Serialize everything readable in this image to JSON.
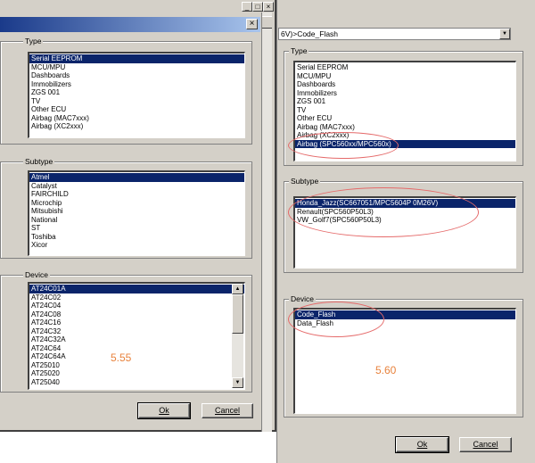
{
  "left_dialog": {
    "type_label": "Type",
    "type_items": [
      "Serial EEPROM",
      "MCU/MPU",
      "Dashboards",
      "Immobilizers",
      "ZGS 001",
      "TV",
      "Other ECU",
      "Airbag (MAC7xxx)",
      "Airbag (XC2xxx)"
    ],
    "type_selected": 0,
    "subtype_label": "Subtype",
    "subtype_items": [
      "Atmel",
      "Catalyst",
      "FAIRCHILD",
      "Microchip",
      "Mitsubishi",
      "National",
      "ST",
      "Toshiba",
      "Xicor"
    ],
    "subtype_selected": 0,
    "device_label": "Device",
    "device_items": [
      "AT24C01A",
      "AT24C02",
      "AT24C04",
      "AT24C08",
      "AT24C16",
      "AT24C32",
      "AT24C32A",
      "AT24C64",
      "AT24C64A",
      "AT25010",
      "AT25020",
      "AT25040"
    ],
    "device_selected": 0,
    "version_label": "5.55",
    "ok_label": "Ok",
    "cancel_label": "Cancel",
    "title_buttons": [
      "_",
      "□",
      "×"
    ],
    "close_glyph": "×"
  },
  "right_dialog": {
    "path_text": "6V)>Code_Flash",
    "type_label": "Type",
    "type_items": [
      "Serial EEPROM",
      "MCU/MPU",
      "Dashboards",
      "Immobilizers",
      "ZGS 001",
      "TV",
      "Other ECU",
      "Airbag (MAC7xxx)",
      "Airbag (XC2xxx)",
      "Airbag (SPC560xx/MPC560x)"
    ],
    "type_selected": 9,
    "subtype_label": "Subtype",
    "subtype_items": [
      "Honda_Jazz(SC667051/MPC5604P 0M26V)",
      "Renault(SPC560P50L3)",
      "VW_Golf7(SPC560P50L3)"
    ],
    "subtype_selected": 0,
    "device_label": "Device",
    "device_items": [
      "Code_Flash",
      "Data_Flash"
    ],
    "device_selected": 0,
    "version_label": "5.60",
    "ok_label": "Ok",
    "cancel_label": "Cancel",
    "dropdown_glyph": "▼"
  },
  "colors": {
    "selection": "#0a246a",
    "dialog_bg": "#d4d0c8",
    "annotation": "#e56a6a",
    "version_text": "#e8823c"
  }
}
